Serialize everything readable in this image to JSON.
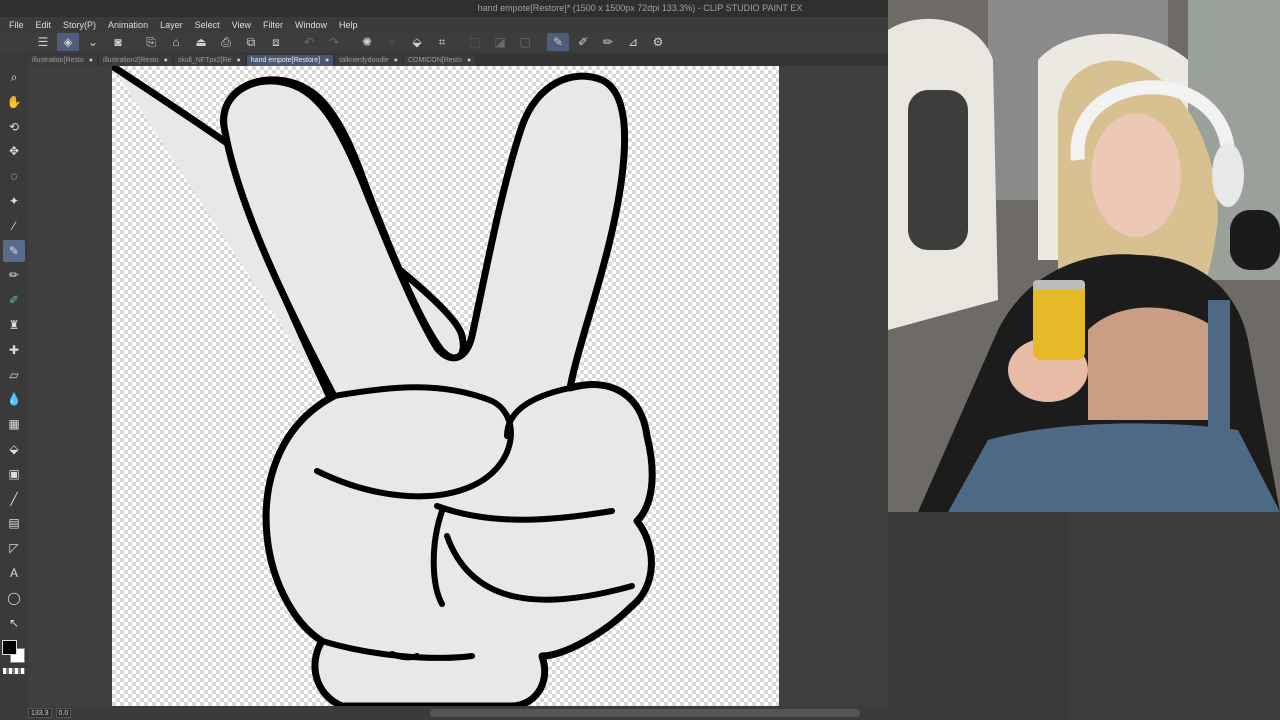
{
  "window": {
    "title": "hand empote[Restore]* (1500 x 1500px 72dpi 133.3%)  - CLIP STUDIO PAINT EX",
    "controls": [
      "–",
      "□"
    ]
  },
  "menu": [
    "File",
    "Edit",
    "Story(P)",
    "Animation",
    "Layer",
    "Select",
    "View",
    "Filter",
    "Window",
    "Help"
  ],
  "toolbar": {
    "buttons": [
      {
        "icon": "menu-icon",
        "glyph": "☰",
        "state": "normal"
      },
      {
        "icon": "clip-studio-icon",
        "glyph": "◈",
        "state": "active"
      },
      {
        "icon": "chevron-down-icon",
        "glyph": "⌄",
        "state": "normal"
      },
      {
        "icon": "camera-icon",
        "glyph": "◙",
        "state": "normal"
      },
      {
        "icon": "new-file-icon",
        "glyph": "⎘",
        "state": "normal"
      },
      {
        "icon": "open-folder-icon",
        "glyph": "⌂",
        "state": "normal"
      },
      {
        "icon": "save-icon",
        "glyph": "⏏",
        "state": "normal"
      },
      {
        "icon": "export-icon",
        "glyph": "⎙",
        "state": "normal"
      },
      {
        "icon": "layers-icon",
        "glyph": "⧉",
        "state": "normal"
      },
      {
        "icon": "layers2-icon",
        "glyph": "⧈",
        "state": "normal"
      },
      {
        "icon": "undo-icon",
        "glyph": "↶",
        "state": "dim"
      },
      {
        "icon": "redo-icon",
        "glyph": "↷",
        "state": "dim"
      },
      {
        "icon": "spinner-icon",
        "glyph": "✺",
        "state": "normal"
      },
      {
        "icon": "clear-icon",
        "glyph": "▫",
        "state": "dim"
      },
      {
        "icon": "fill-icon",
        "glyph": "⬙",
        "state": "normal"
      },
      {
        "icon": "crop-icon",
        "glyph": "⌗",
        "state": "normal"
      },
      {
        "icon": "transform-icon",
        "glyph": "⬚",
        "state": "dim"
      },
      {
        "icon": "mesh-icon",
        "glyph": "◪",
        "state": "dim"
      },
      {
        "icon": "rect-icon",
        "glyph": "▢",
        "state": "dim"
      },
      {
        "icon": "pen-icon",
        "glyph": "✎",
        "state": "active"
      },
      {
        "icon": "brush-icon",
        "glyph": "✐",
        "state": "normal"
      },
      {
        "icon": "pencil-icon",
        "glyph": "✏",
        "state": "normal"
      },
      {
        "icon": "ruler-icon",
        "glyph": "⊿",
        "state": "normal"
      },
      {
        "icon": "settings-icon",
        "glyph": "⚙",
        "state": "normal"
      }
    ]
  },
  "tabs": [
    {
      "label": "illustration[Resto",
      "active": false
    },
    {
      "label": "illustration2[Resto",
      "active": false
    },
    {
      "label": "skull_NFTpx2[Re",
      "active": false
    },
    {
      "label": "hand empote[Restore]",
      "active": true
    },
    {
      "label": "talknerdydoodle",
      "active": false
    },
    {
      "label": "COMICON[Resto",
      "active": false
    }
  ],
  "tools": [
    {
      "name": "zoom-tool-icon",
      "glyph": "⌕"
    },
    {
      "name": "hand-tool-icon",
      "glyph": "✋"
    },
    {
      "name": "rotate-tool-icon",
      "glyph": "⟲"
    },
    {
      "name": "move-tool-icon",
      "glyph": "✥"
    },
    {
      "name": "lasso-tool-icon",
      "glyph": "◌"
    },
    {
      "name": "magic-wand-tool-icon",
      "glyph": "✦"
    },
    {
      "name": "eyedropper-tool-icon",
      "glyph": "⁄"
    },
    {
      "name": "pen-tool-icon",
      "glyph": "✎",
      "active": true
    },
    {
      "name": "pencil-tool-icon",
      "glyph": "✏"
    },
    {
      "name": "brush-tool-icon",
      "glyph": "✐",
      "teal": true
    },
    {
      "name": "airbrush-tool-icon",
      "glyph": "♜"
    },
    {
      "name": "decoration-tool-icon",
      "glyph": "✚"
    },
    {
      "name": "eraser-tool-icon",
      "glyph": "▱"
    },
    {
      "name": "blend-tool-icon",
      "glyph": "💧"
    },
    {
      "name": "frame-tool-icon",
      "glyph": "▦"
    },
    {
      "name": "fill-tool-icon",
      "glyph": "⬙"
    },
    {
      "name": "gradient-tool-icon",
      "glyph": "▣"
    },
    {
      "name": "line-tool-icon",
      "glyph": "╱"
    },
    {
      "name": "panel-tool-icon",
      "glyph": "▤"
    },
    {
      "name": "ruler-tool-icon",
      "glyph": "◸"
    },
    {
      "name": "text-tool-icon",
      "glyph": "A"
    },
    {
      "name": "balloon-tool-icon",
      "glyph": "◯"
    },
    {
      "name": "correct-line-tool-icon",
      "glyph": "↖"
    }
  ],
  "status": {
    "zoom": "133.3",
    "angle": "0.0"
  }
}
